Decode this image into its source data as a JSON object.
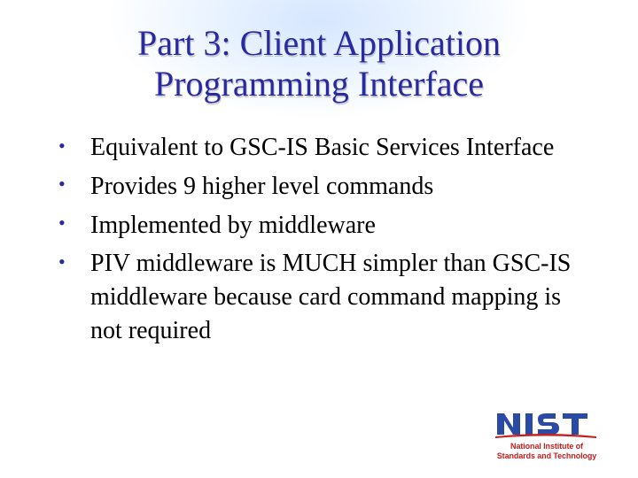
{
  "title": {
    "line1": "Part 3:  Client Application",
    "line2": "Programming Interface"
  },
  "bullets": [
    "Equivalent to GSC-IS Basic Services Interface",
    "Provides 9 higher level commands",
    "Implemented by middleware",
    "PIV middleware is MUCH simpler than GSC-IS middleware because card command mapping is not required"
  ],
  "logo": {
    "name": "NIST",
    "tagline1": "National Institute of",
    "tagline2": "Standards and Technology"
  }
}
